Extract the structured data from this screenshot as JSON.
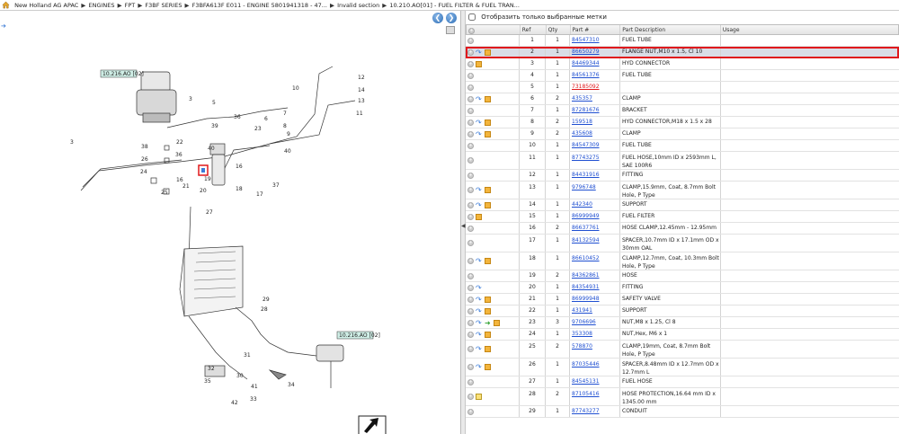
{
  "breadcrumb": [
    "New Holland AG APAC",
    "ENGINES",
    "FPT",
    "F3BF SERIES",
    "F3BFA613F E011 - ENGINE 5801941318 - 47...",
    "Invalid section",
    "10.210.AO[01] - FUEL FILTER & FUEL TRAN..."
  ],
  "filter": {
    "label": "Отобразить только выбранные метки"
  },
  "table": {
    "headers": [
      "",
      "Ref",
      "Qty",
      "Part #",
      "Part Description",
      "Usage"
    ],
    "rows": [
      {
        "ref": "1",
        "qty": "1",
        "part": "84547310",
        "desc": "FUEL TUBE",
        "icons": [
          "circle"
        ]
      },
      {
        "ref": "2",
        "qty": "1",
        "part": "86650279",
        "desc": "FLANGE NUT,M10 x 1.5, Cl 10",
        "icons": [
          "circle",
          "arrow",
          "box"
        ],
        "selected": true
      },
      {
        "ref": "3",
        "qty": "1",
        "part": "84469344",
        "desc": "HYD CONNECTOR",
        "icons": [
          "circle",
          "box"
        ]
      },
      {
        "ref": "4",
        "qty": "1",
        "part": "84561376",
        "desc": "FUEL TUBE",
        "icons": [
          "circle"
        ]
      },
      {
        "ref": "5",
        "qty": "1",
        "part": "73185092",
        "desc": "",
        "icons": [
          "circle"
        ],
        "red": true
      },
      {
        "ref": "6",
        "qty": "2",
        "part": "435357",
        "desc": "CLAMP",
        "icons": [
          "circle",
          "arrow",
          "box"
        ]
      },
      {
        "ref": "7",
        "qty": "1",
        "part": "87281676",
        "desc": "BRACKET",
        "icons": [
          "circle"
        ]
      },
      {
        "ref": "8",
        "qty": "2",
        "part": "159518",
        "desc": "HYD CONNECTOR,M18 x 1.5 x 28",
        "icons": [
          "circle",
          "arrow",
          "box"
        ]
      },
      {
        "ref": "9",
        "qty": "2",
        "part": "435608",
        "desc": "CLAMP",
        "icons": [
          "circle",
          "arrow",
          "box"
        ]
      },
      {
        "ref": "10",
        "qty": "1",
        "part": "84547309",
        "desc": "FUEL TUBE",
        "icons": [
          "circle"
        ]
      },
      {
        "ref": "11",
        "qty": "1",
        "part": "87743275",
        "desc": "FUEL HOSE,10mm ID x 2593mm L, SAE 100R6",
        "icons": [
          "circle"
        ]
      },
      {
        "ref": "12",
        "qty": "1",
        "part": "84431916",
        "desc": "FITTING",
        "icons": [
          "circle"
        ]
      },
      {
        "ref": "13",
        "qty": "1",
        "part": "9796748",
        "desc": "CLAMP,15.9mm, Coat, 8.7mm Bolt Hole, P Type",
        "icons": [
          "circle",
          "arrow",
          "box"
        ]
      },
      {
        "ref": "14",
        "qty": "1",
        "part": "442340",
        "desc": "SUPPORT",
        "icons": [
          "circle",
          "arrow",
          "box"
        ]
      },
      {
        "ref": "15",
        "qty": "1",
        "part": "86999949",
        "desc": "FUEL FILTER",
        "icons": [
          "circle",
          "box"
        ]
      },
      {
        "ref": "16",
        "qty": "2",
        "part": "86637761",
        "desc": "HOSE CLAMP,12.45mm - 12.95mm",
        "icons": [
          "circle"
        ]
      },
      {
        "ref": "17",
        "qty": "1",
        "part": "84132594",
        "desc": "SPACER,10.7mm ID x 17.1mm OD x 30mm OAL",
        "icons": [
          "circle"
        ]
      },
      {
        "ref": "18",
        "qty": "1",
        "part": "86610452",
        "desc": "CLAMP,12.7mm, Coat, 10.3mm Bolt Hole, P Type",
        "icons": [
          "circle",
          "arrow",
          "box"
        ]
      },
      {
        "ref": "19",
        "qty": "2",
        "part": "84362861",
        "desc": "HOSE",
        "icons": [
          "circle"
        ]
      },
      {
        "ref": "20",
        "qty": "1",
        "part": "84354931",
        "desc": "FITTING",
        "icons": [
          "circle",
          "arrow"
        ]
      },
      {
        "ref": "21",
        "qty": "1",
        "part": "86999948",
        "desc": "SAFETY VALVE",
        "icons": [
          "circle",
          "arrow",
          "box"
        ]
      },
      {
        "ref": "22",
        "qty": "1",
        "part": "431941",
        "desc": "SUPPORT",
        "icons": [
          "circle",
          "arrow",
          "box"
        ]
      },
      {
        "ref": "23",
        "qty": "3",
        "part": "9706696",
        "desc": "NUT,M8 x 1.25, Cl 8",
        "icons": [
          "circle",
          "arrow",
          "green",
          "box"
        ]
      },
      {
        "ref": "24",
        "qty": "1",
        "part": "353308",
        "desc": "NUT,Hex, M6 x 1",
        "icons": [
          "circle",
          "arrow",
          "box"
        ]
      },
      {
        "ref": "25",
        "qty": "2",
        "part": "578870",
        "desc": "CLAMP,19mm, Coat, 8.7mm Bolt Hole, P Type",
        "icons": [
          "circle",
          "arrow",
          "box"
        ]
      },
      {
        "ref": "26",
        "qty": "1",
        "part": "87035446",
        "desc": "SPACER,8.48mm ID x 12.7mm OD x 12.7mm L",
        "icons": [
          "circle",
          "arrow",
          "box"
        ]
      },
      {
        "ref": "27",
        "qty": "1",
        "part": "84545131",
        "desc": "FUEL HOSE",
        "icons": [
          "circle"
        ]
      },
      {
        "ref": "28",
        "qty": "2",
        "part": "87105416",
        "desc": "HOSE PROTECTION,16.64 mm ID x 1345.00 mm",
        "icons": [
          "circle",
          "note"
        ]
      },
      {
        "ref": "29",
        "qty": "1",
        "part": "87743277",
        "desc": "CONDUIT",
        "icons": [
          "circle"
        ]
      }
    ]
  },
  "diagram": {
    "refs": [
      "10.216.AO [02]",
      "10.216.AO [02]"
    ]
  },
  "colors": {
    "accent": "#1f4fd1",
    "highlight": "#e0181c",
    "selected_row": "#d9dde6"
  }
}
